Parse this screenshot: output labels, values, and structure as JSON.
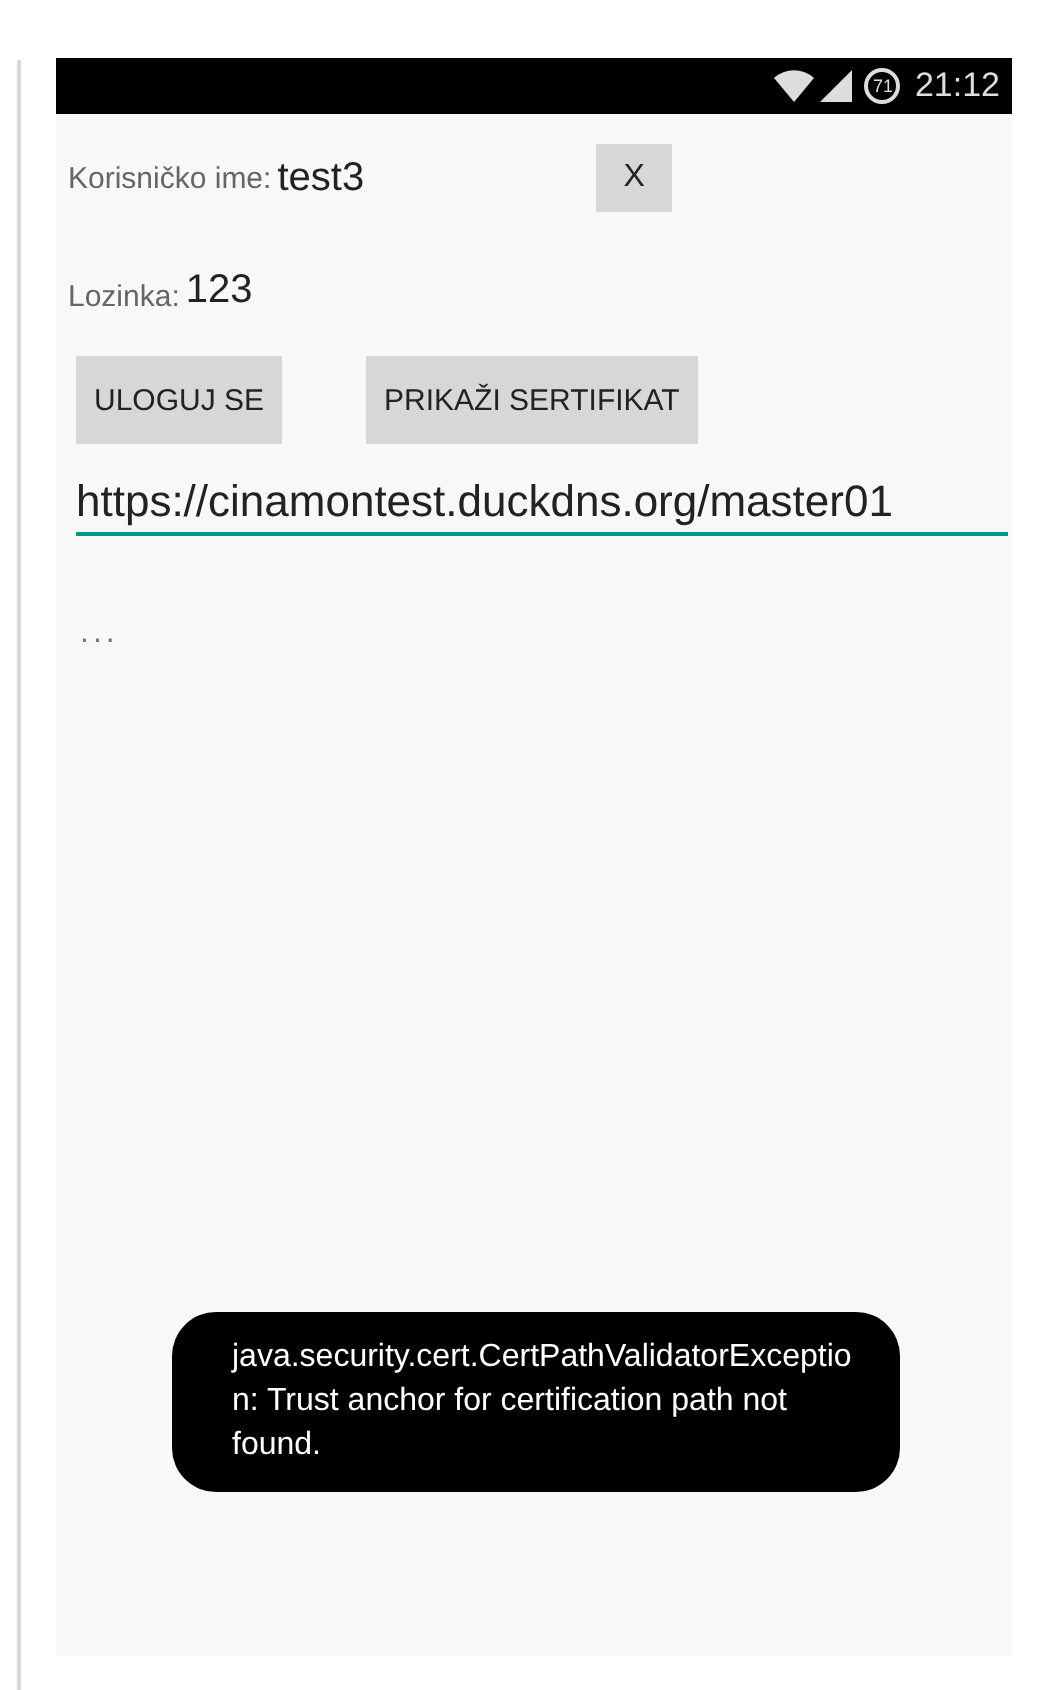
{
  "status_bar": {
    "battery": "71",
    "time": "21:12"
  },
  "username": {
    "label": "Korisničko ime:",
    "value": "test3",
    "clear_button": "X"
  },
  "password": {
    "label": "Lozinka:",
    "value": "123"
  },
  "buttons": [
    "ULOGUJ SE",
    "PRIKAŽI SERTIFIKAT"
  ],
  "url_field": {
    "value": "https://cinamontest.duckdns.org/master01"
  },
  "result": "...",
  "toast": "java.security.cert.CertPathValidatorException: Trust anchor for certification path not found."
}
